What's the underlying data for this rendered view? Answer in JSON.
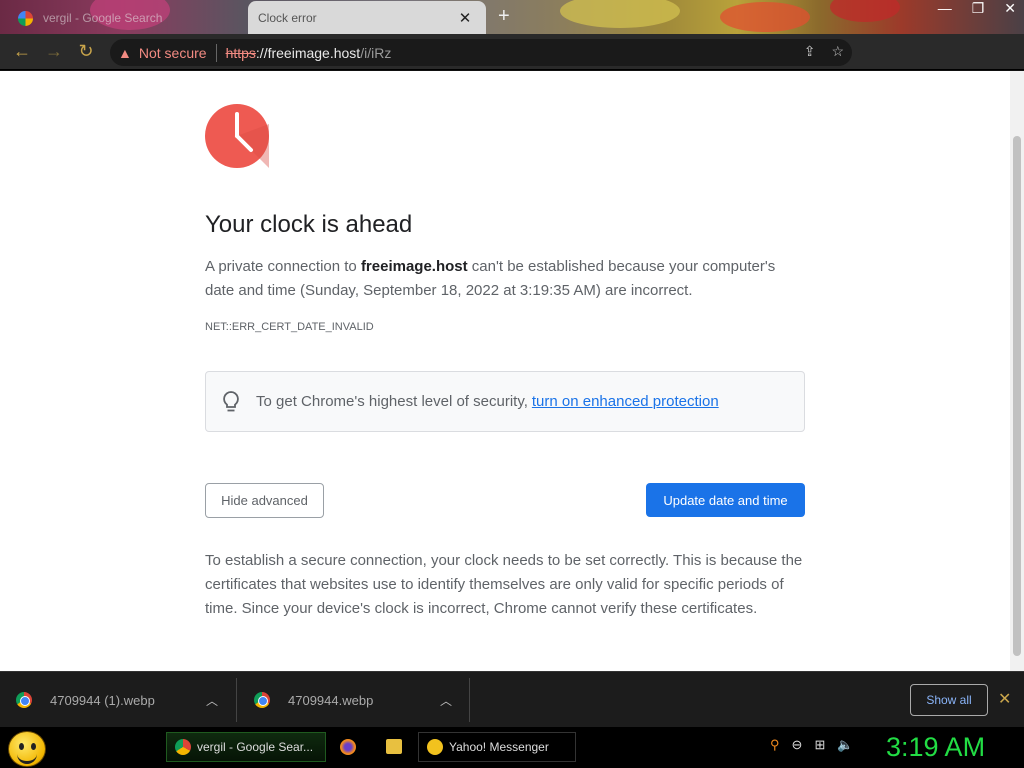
{
  "browser": {
    "tabs": [
      {
        "title": "vergil - Google Search",
        "active": false
      },
      {
        "title": "Clock error",
        "active": true
      }
    ],
    "address": {
      "security_label": "Not secure",
      "scheme": "https",
      "host": "://freeimage.host",
      "path": "/i/iRz"
    }
  },
  "page": {
    "heading": "Your clock is ahead",
    "desc_prefix": "A private connection to ",
    "desc_host": "freeimage.host",
    "desc_suffix": " can't be established because your computer's date and time (Sunday, September 18, 2022 at 3:19:35 AM) are incorrect.",
    "error_code": "NET::ERR_CERT_DATE_INVALID",
    "enhanced_text": "To get Chrome's highest level of security,",
    "enhanced_link": "turn on enhanced protection",
    "hide_advanced": "Hide advanced",
    "update_button": "Update date and time",
    "details": "To establish a secure connection, your clock needs to be set correctly. This is because the certificates that websites use to identify themselves are only valid for specific periods of time. Since your device's clock is incorrect, Chrome cannot verify these certificates."
  },
  "downloads": {
    "items": [
      {
        "name": "4709944 (1).webp"
      },
      {
        "name": "4709944.webp"
      }
    ],
    "show_all": "Show all"
  },
  "taskbar": {
    "tasks": [
      {
        "label": "vergil - Google Sear..."
      },
      {
        "label": "Yahoo! Messenger"
      }
    ],
    "clock": "3:19 AM"
  },
  "colors": {
    "accent": "#1a73e8",
    "warning": "#f28b82",
    "clock_icon": "#ee5a52",
    "taskbar_clock": "#22dd44"
  }
}
